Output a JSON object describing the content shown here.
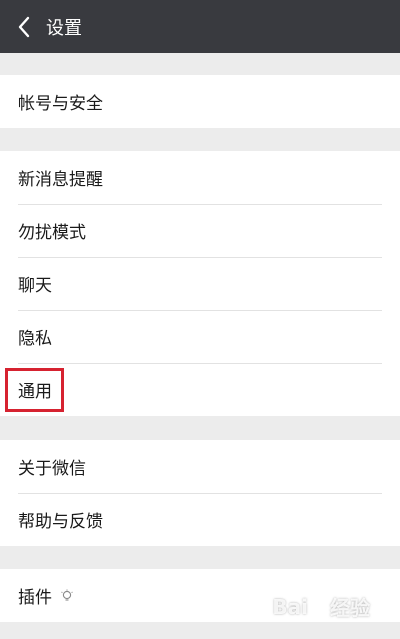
{
  "header": {
    "title": "设置",
    "back_icon": "chevron-left-icon"
  },
  "groups": [
    {
      "items": [
        "帐号与安全"
      ]
    },
    {
      "items": [
        "新消息提醒",
        "勿扰模式",
        "聊天",
        "隐私",
        "通用"
      ]
    },
    {
      "items": [
        "关于微信",
        "帮助与反馈"
      ]
    },
    {
      "items": [
        "插件"
      ]
    }
  ],
  "plugin_icon": "bulb-icon",
  "highlight": {
    "target": "通用",
    "color": "#d62230"
  },
  "watermark": {
    "left": "Bai",
    "right": "经验",
    "icon": "paw-icon"
  },
  "colors": {
    "titlebar": "#393a3f",
    "background": "#ececec",
    "cell": "#ffffff"
  }
}
